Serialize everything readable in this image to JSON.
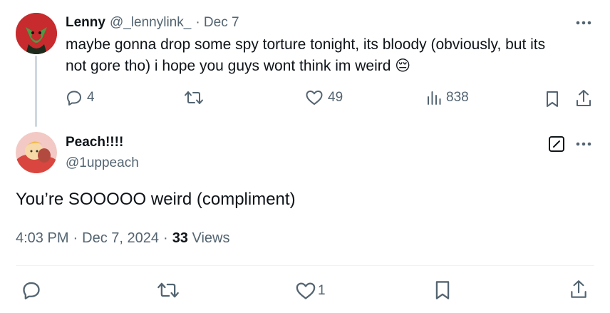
{
  "parent_tweet": {
    "name": "Lenny",
    "handle": "@_lennylink_",
    "date": "· Dec 7",
    "text_line1": "maybe gonna drop some spy torture tonight, its bloody (obviously, but its",
    "text_line2": "not gore tho) i hope you guys wont think im weird",
    "emoji": "😔",
    "stats": {
      "replies": "4",
      "likes": "49",
      "views": "838"
    }
  },
  "reply_tweet": {
    "name": "Peach!!!!",
    "handle": "@1uppeach",
    "text": "You’re SOOOOO weird (compliment)",
    "time": "4:03 PM",
    "date": "Dec 7, 2024",
    "views_count": "33",
    "views_label": "Views",
    "stats": {
      "likes": "1"
    }
  },
  "icons": [
    "more-icon",
    "reply-icon",
    "retweet-icon",
    "like-icon",
    "views-icon",
    "bookmark-icon",
    "share-icon",
    "edit-icon"
  ]
}
